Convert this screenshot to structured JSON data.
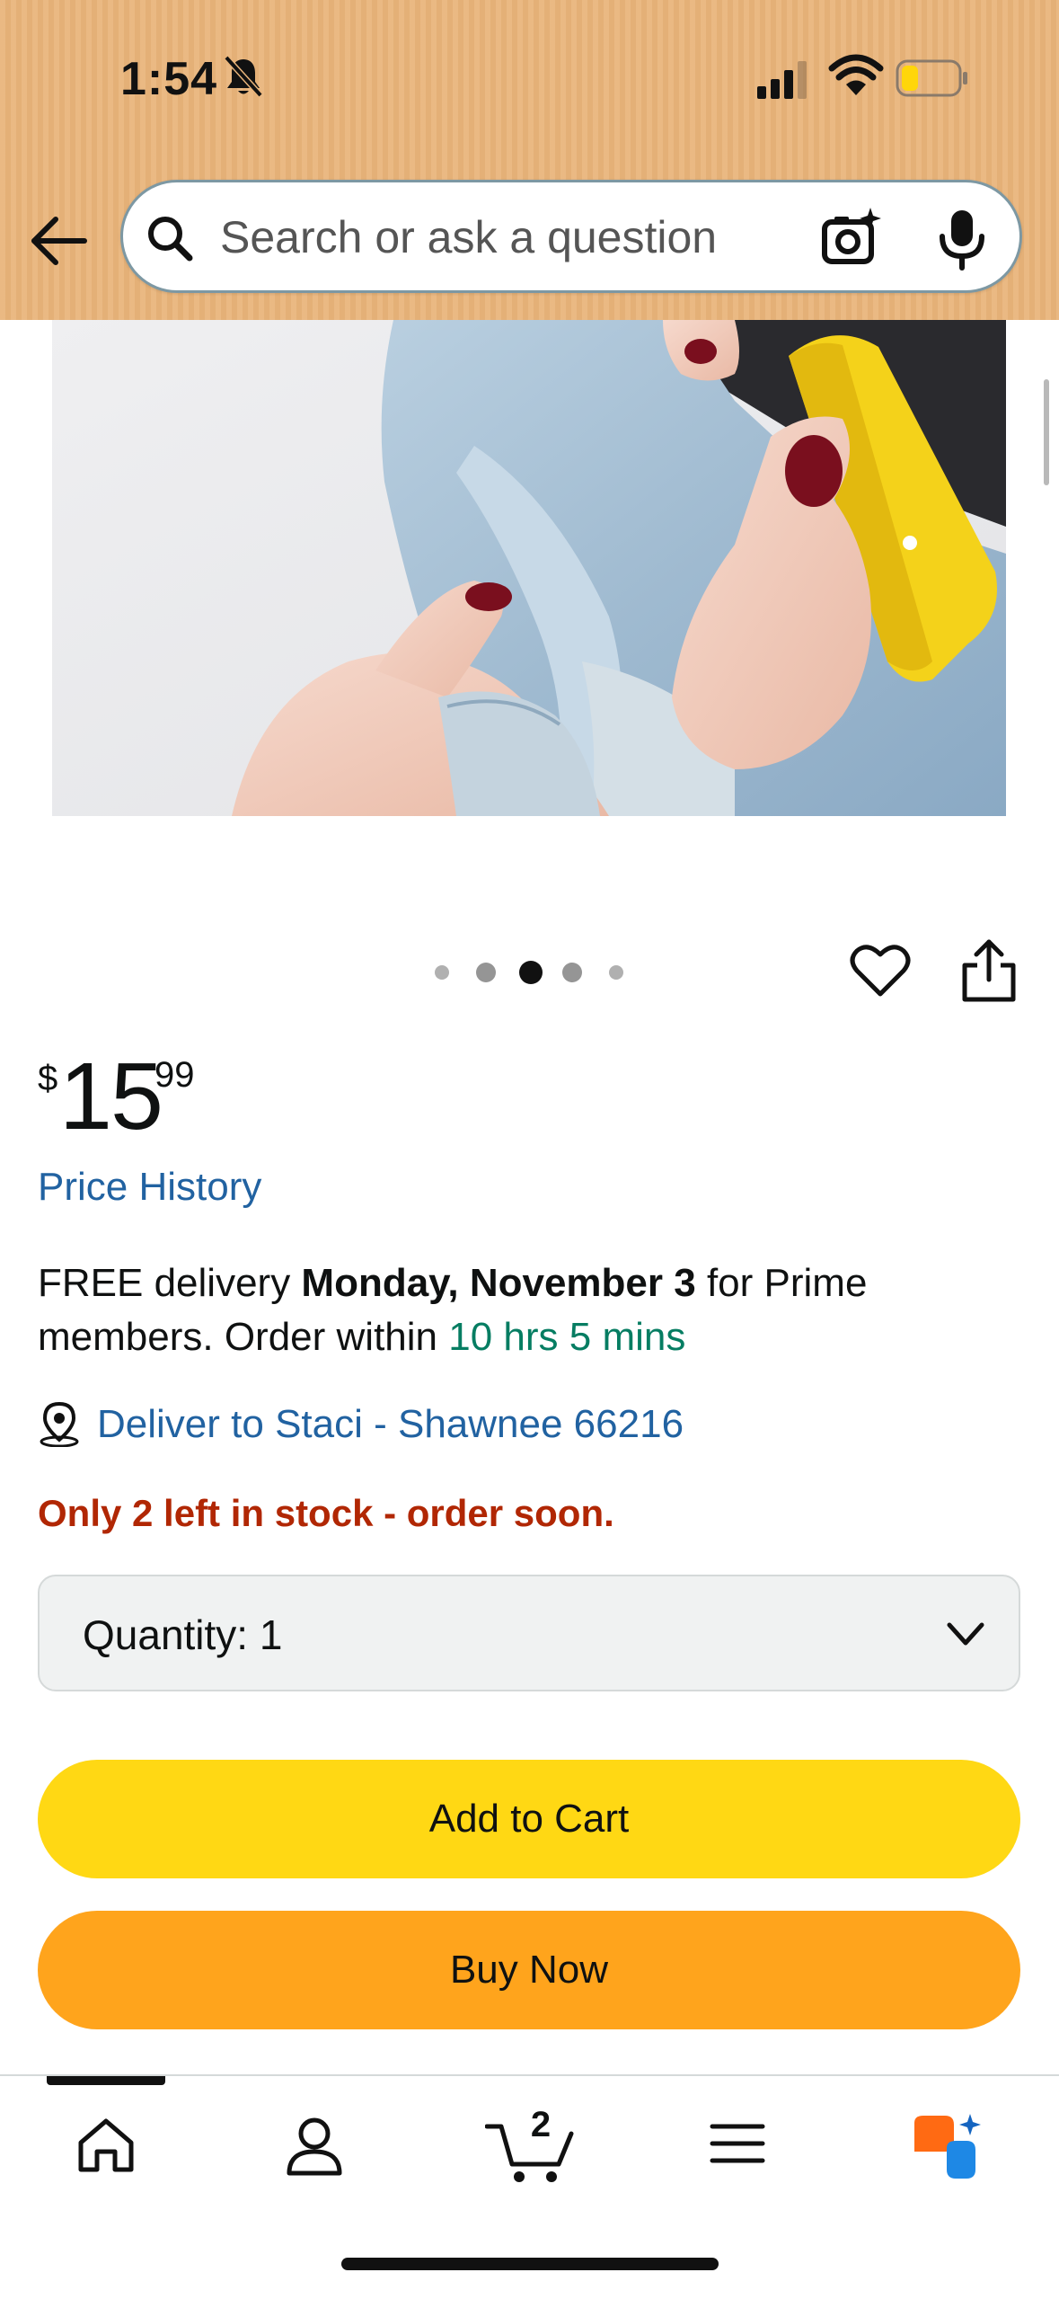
{
  "status_bar": {
    "time": "1:54"
  },
  "search": {
    "placeholder": "Search or ask a question"
  },
  "carousel": {
    "image_count": 5,
    "active_index": 2
  },
  "price": {
    "symbol": "$",
    "whole": "15",
    "fraction": "99"
  },
  "price_history": "Price History",
  "delivery": {
    "prefix": "FREE delivery ",
    "date": "Monday, November 3",
    "middle": " for Prime members. Order within ",
    "countdown": "10 hrs 5 mins"
  },
  "deliver_to": "Deliver to Staci - Shawnee 66216",
  "stock": "Only 2 left in stock - order soon.",
  "quantity": {
    "label": "Quantity:",
    "value": "1"
  },
  "buttons": {
    "add_to_cart": "Add to Cart",
    "buy_now": "Buy Now"
  },
  "nav": {
    "cart_count": "2"
  },
  "colors": {
    "header_bg": "#e9b47a",
    "link": "#2162a1",
    "countdown": "#067d62",
    "stock": "#b12704",
    "add_to_cart": "#ffd814",
    "buy_now": "#ffa41c"
  },
  "icons": [
    "bell-slash-icon",
    "signal-icon",
    "wifi-icon",
    "battery-icon",
    "back-arrow-icon",
    "search-icon",
    "camera-sparkle-icon",
    "microphone-icon",
    "heart-icon",
    "share-icon",
    "location-pin-icon",
    "chevron-down-icon",
    "home-icon",
    "account-icon",
    "cart-icon",
    "menu-icon",
    "rufus-icon"
  ]
}
